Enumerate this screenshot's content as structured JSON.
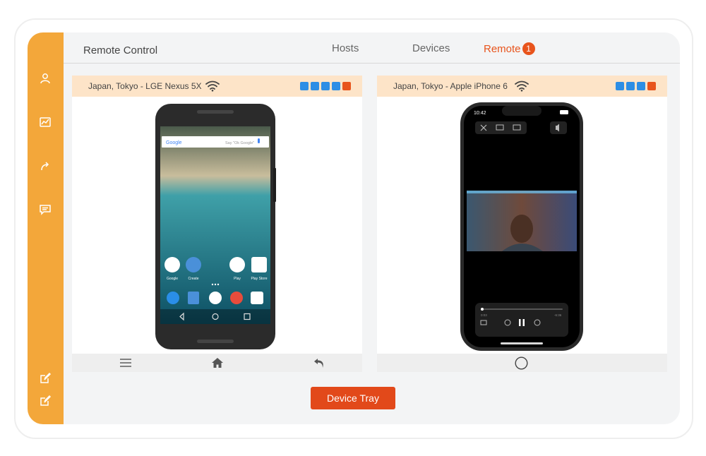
{
  "header": {
    "title": "Remote Control",
    "tabs": [
      {
        "label": "Hosts"
      },
      {
        "label": "Devices"
      },
      {
        "label": "Remote",
        "badge": "1"
      }
    ]
  },
  "sidebar": {
    "icons": [
      "user-icon",
      "chart-icon",
      "share-icon",
      "chat-icon",
      "edit-icon",
      "edit-icon"
    ]
  },
  "devices": [
    {
      "location_name": "Japan, Tokyo - LGE Nexus 5X",
      "screen": {
        "search_brand": "Google",
        "search_hint": "Say \"Ok Google\"",
        "apps": [
          {
            "label": "Google"
          },
          {
            "label": "Create"
          },
          {
            "label": "Play"
          },
          {
            "label": "Play Store"
          }
        ]
      }
    },
    {
      "location_name": "Japan, Tokyo - Apple iPhone 6",
      "screen": {
        "time": "10:42",
        "elapsed": "0:03",
        "remaining": "-6:36"
      }
    }
  ],
  "actions": {
    "device_tray": "Device Tray"
  },
  "colors": {
    "sidebar": "#f3a73a",
    "accent": "#e8541c",
    "control_blue": "#2d8ee5",
    "panel_header": "#fde4c8"
  }
}
